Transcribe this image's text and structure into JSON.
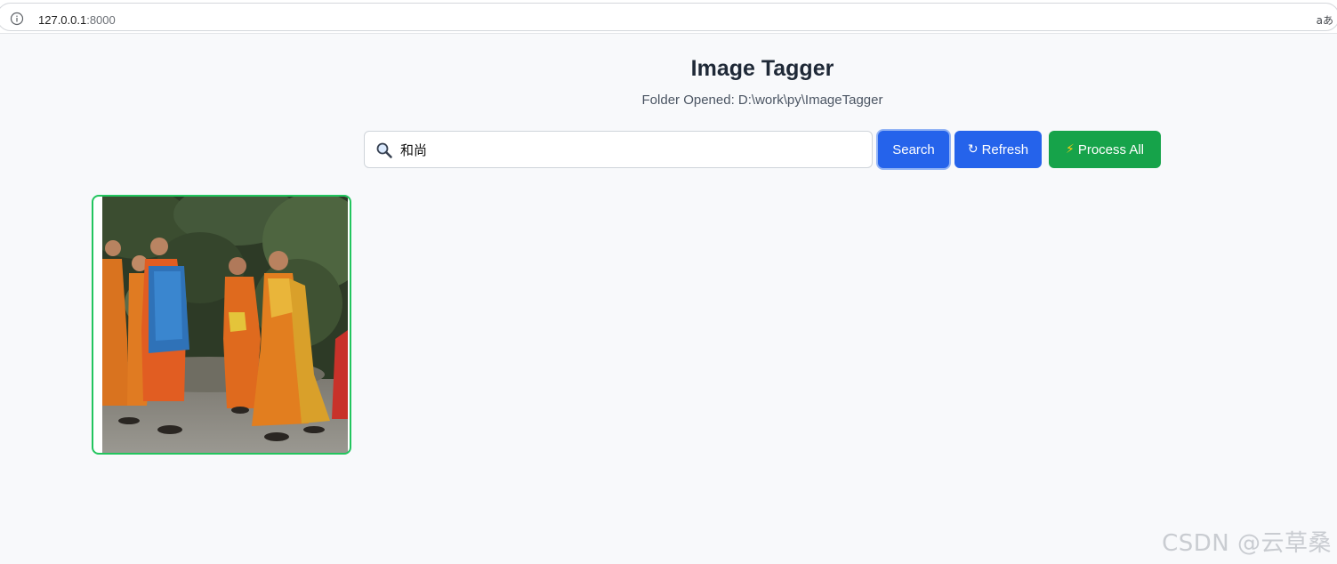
{
  "browser": {
    "url_host": "127.0.0.1",
    "url_port": ":8000",
    "reader_label": "aあ"
  },
  "header": {
    "title": "Image Tagger",
    "folder_text": "Folder Opened: D:\\work\\py\\ImageTagger"
  },
  "search": {
    "value": "和尚",
    "icon": "magnifier-icon"
  },
  "buttons": {
    "search_label": "Search",
    "refresh_glyph": "↻",
    "refresh_label": "Refresh",
    "process_glyph": "⚡",
    "process_label": "Process All"
  },
  "gallery": {
    "images": [
      {
        "subject": "monks-walking-photo",
        "selected": true
      }
    ]
  },
  "watermark": "CSDN @云草桑",
  "colors": {
    "primary": "#2563eb",
    "success": "#16a34a",
    "selected_border": "#22c55e"
  }
}
